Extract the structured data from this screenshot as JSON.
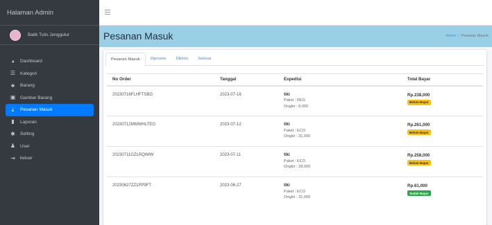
{
  "sidebar": {
    "brand": "Halaman Admin",
    "user_name": "Batik Tulis Jenggulur",
    "items": [
      {
        "icon": "dashboard-icon",
        "glyph": "◕",
        "label": "Dashboard"
      },
      {
        "icon": "list-icon",
        "glyph": "☰",
        "label": "Kategori"
      },
      {
        "icon": "cubes-icon",
        "glyph": "♣",
        "label": "Barang"
      },
      {
        "icon": "image-icon",
        "glyph": "▣",
        "label": "Gambar Barang"
      },
      {
        "icon": "download-icon",
        "glyph": "⤓",
        "label": "Pesanan Masuk",
        "active": true
      },
      {
        "icon": "file-icon",
        "glyph": "▮",
        "label": "Laporan"
      },
      {
        "icon": "cog-icon",
        "glyph": "✱",
        "label": "Setting"
      },
      {
        "icon": "users-icon",
        "glyph": "♟",
        "label": "User"
      },
      {
        "icon": "logout-icon",
        "glyph": "⇥",
        "label": "keluar"
      }
    ]
  },
  "header": {
    "title": "Pesanan Masuk",
    "breadcrumb": [
      "Home",
      "Pesanan Masuk"
    ]
  },
  "tabs": [
    "Pesanan Masuk",
    "Diproses",
    "Dikirim",
    "Selesai"
  ],
  "table": {
    "headers": [
      "No Order",
      "Tanggal",
      "Expedisi",
      "Total Bayar"
    ],
    "rows": [
      {
        "order": "20230716FLHFTSBG",
        "date": "2023-07-16",
        "courier": "tiki",
        "paket": "Paket : REG",
        "ongkir": "Ongkir : 8,000",
        "total": "Rp.238,000",
        "status": "Belum Bayar",
        "status_type": "warn"
      },
      {
        "order": "20230712MMWHLTEO",
        "date": "2023-07-12",
        "courier": "tiki",
        "paket": "Paket : ECO",
        "ongkir": "Ongkir : 31,000",
        "total": "Rp.261,000",
        "status": "Belum Bayar",
        "status_type": "warn"
      },
      {
        "order": "20230711GZLRQIMW",
        "date": "2023-07-11",
        "courier": "tiki",
        "paket": "Paket : ECO",
        "ongkir": "Ongkir : 28,000",
        "total": "Rp.258,000",
        "status": "Belum Bayar",
        "status_type": "warn"
      },
      {
        "order": "20230627ZZ1PP9FT",
        "date": "2023-06-27",
        "courier": "tiki",
        "paket": "Paket : ECO",
        "ongkir": "Ongkir : 31,000",
        "total": "Rp.61,000",
        "status": "Sudah Bayar",
        "status_type": "ok"
      }
    ]
  },
  "colors": {
    "sidebar_bg": "#343a40",
    "active": "#007bff",
    "header_bg": "#9ad0e6",
    "badge_warn": "#ffc107",
    "badge_ok": "#28a745"
  }
}
